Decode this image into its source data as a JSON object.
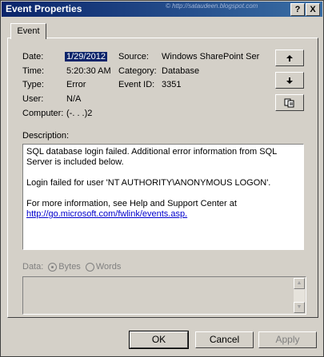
{
  "window": {
    "title": "Event Properties",
    "watermark": "© http://sataudeen.blogspot.com",
    "help_glyph": "?",
    "close_glyph": "X"
  },
  "tabs": [
    {
      "label": "Event"
    }
  ],
  "event": {
    "date_label": "Date:",
    "date_value": "1/29/2012",
    "time_label": "Time:",
    "time_value": "5:20:30 AM",
    "type_label": "Type:",
    "type_value": "Error",
    "user_label": "User:",
    "user_value": "N/A",
    "computer_label": "Computer:",
    "computer_value": "(-.  .  .)2",
    "source_label": "Source:",
    "source_value": "Windows SharePoint Ser",
    "category_label": "Category:",
    "category_value": "Database",
    "eventid_label": "Event ID:",
    "eventid_value": "3351"
  },
  "side_buttons": {
    "up_icon": "arrow-up-icon",
    "down_icon": "arrow-down-icon",
    "copy_icon": "copy-icon"
  },
  "description": {
    "label": "Description:",
    "paragraph1": "SQL database login failed. Additional error information from SQL Server is included below.",
    "paragraph2": "Login failed for user 'NT AUTHORITY\\ANONYMOUS LOGON'.",
    "paragraph3": "For more information, see Help and Support Center at",
    "link": "http://go.microsoft.com/fwlink/events.asp."
  },
  "data_section": {
    "label": "Data:",
    "bytes_label": "Bytes",
    "words_label": "Words",
    "selected": "Bytes"
  },
  "buttons": {
    "ok": "OK",
    "cancel": "Cancel",
    "apply": "Apply"
  },
  "colors": {
    "titlebar": "#0a246a",
    "face": "#d4d0c8",
    "link": "#0000cc"
  }
}
